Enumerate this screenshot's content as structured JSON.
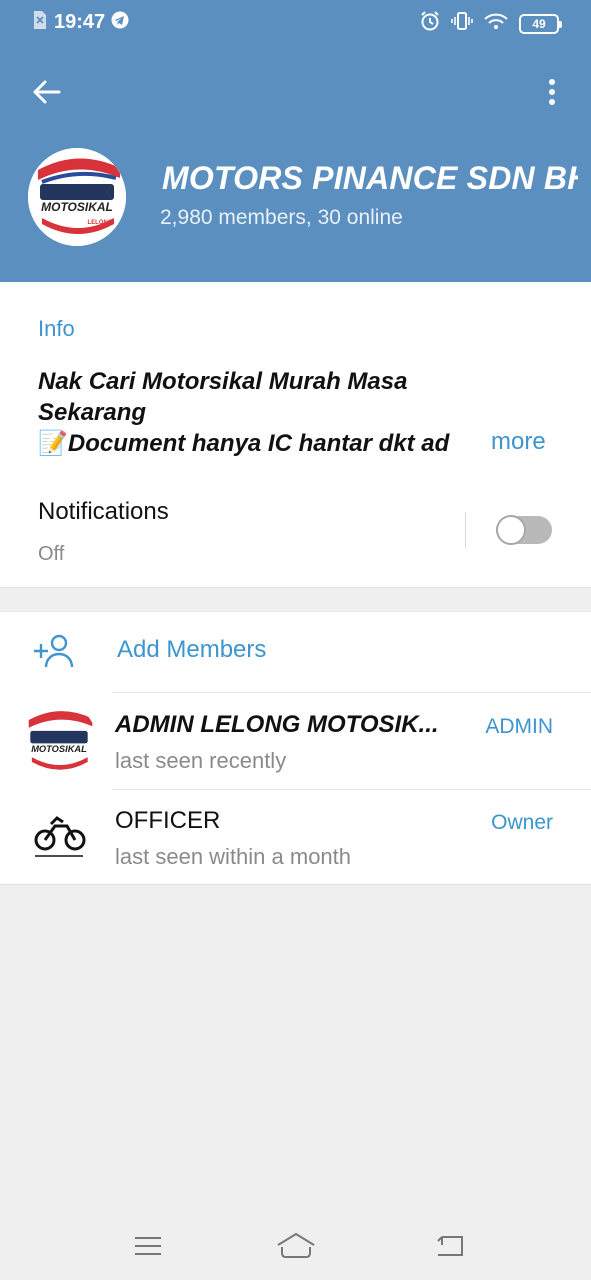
{
  "status_bar": {
    "time": "19:47",
    "battery": "49"
  },
  "group": {
    "title": "MOTORS PINANCE SDN BH",
    "subtitle": "2,980 members, 30 online",
    "avatar_logo_text": "MOTOSIKAL",
    "avatar_logo_sub": "LELONG"
  },
  "info": {
    "heading": "Info",
    "desc_line1": "Nak Cari Motorsikal Murah Masa",
    "desc_line2": "Sekarang",
    "desc_line3_emoji": "📝",
    "desc_line3": "Document hanya IC hantar dkt ad",
    "more_label": "more",
    "notifications_label": "Notifications",
    "notifications_state": "Off"
  },
  "members": {
    "add_label": "Add Members",
    "list": [
      {
        "name": "ADMIN LELONG MOTOSIK...",
        "status": "last seen recently",
        "role": "ADMIN"
      },
      {
        "name": "OFFICER",
        "status": "last seen within a month",
        "role": "Owner"
      }
    ]
  },
  "colors": {
    "header": "#5b8fbf",
    "accent": "#3d95cf"
  }
}
